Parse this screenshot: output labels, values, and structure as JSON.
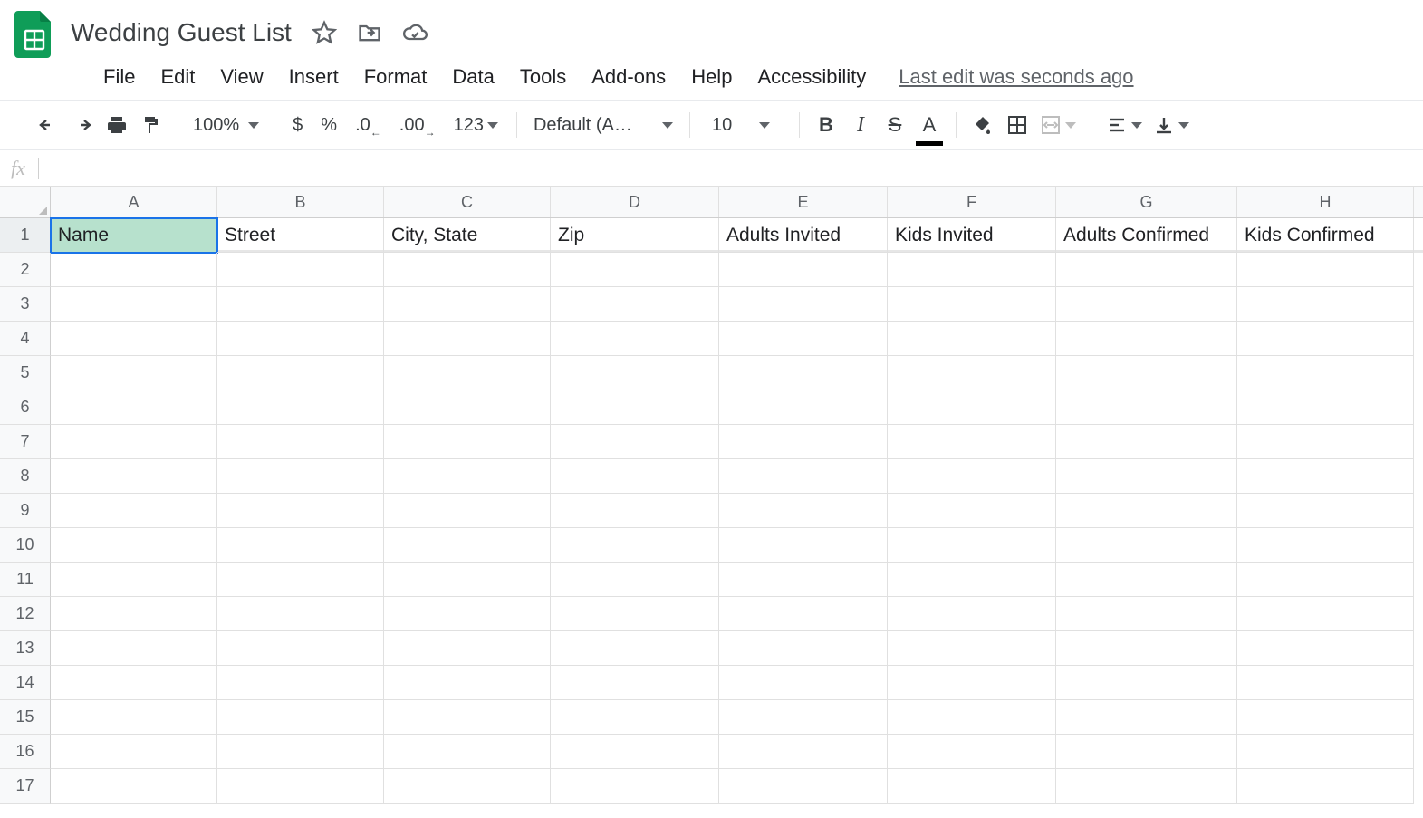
{
  "doc": {
    "title": "Wedding Guest List"
  },
  "menu": {
    "items": [
      "File",
      "Edit",
      "View",
      "Insert",
      "Format",
      "Data",
      "Tools",
      "Add-ons",
      "Help",
      "Accessibility"
    ],
    "edit_status": "Last edit was seconds ago"
  },
  "toolbar": {
    "zoom": "100%",
    "currency": "$",
    "percent": "%",
    "dec_decrease": ".0",
    "dec_increase": ".00",
    "fmt_more": "123",
    "font": "Default (Ari...",
    "font_size": "10",
    "bold": "B",
    "italic": "I",
    "strike": "S",
    "text_color": "A"
  },
  "formula_bar": {
    "fx": "fx",
    "value": ""
  },
  "grid": {
    "columns": [
      "A",
      "B",
      "C",
      "D",
      "E",
      "F",
      "G",
      "H"
    ],
    "row_count": 17,
    "headers_row1": [
      "Name",
      "Street",
      "City, State",
      "Zip",
      "Adults Invited",
      "Kids Invited",
      "Adults Confirmed",
      "Kids Confirmed"
    ],
    "active_cell": {
      "row": 1,
      "col": "A"
    }
  }
}
